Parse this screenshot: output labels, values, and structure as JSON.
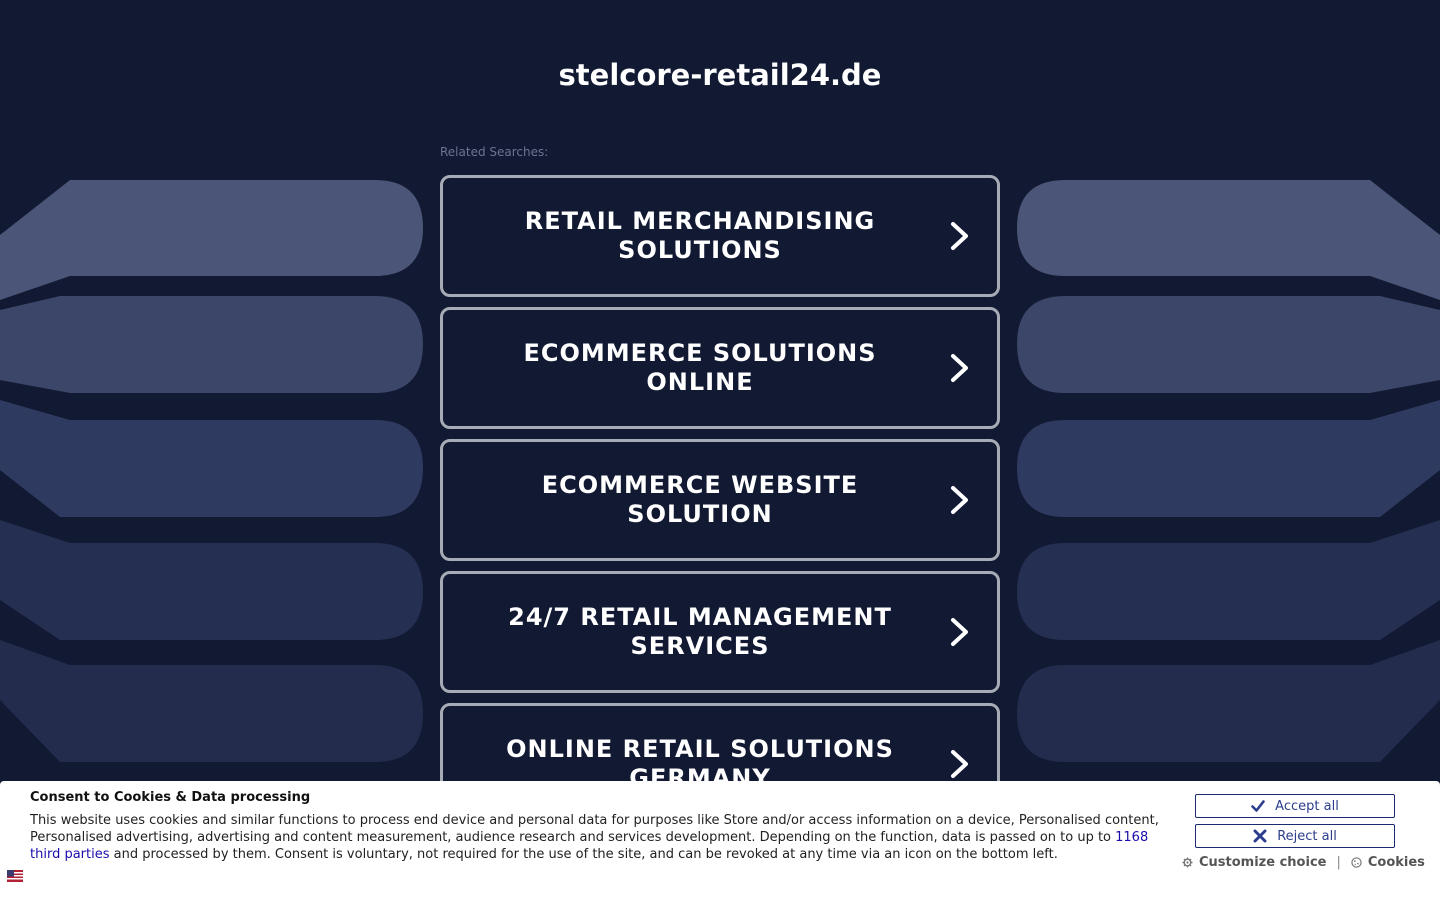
{
  "page": {
    "domain": "stelcore-retail24.de",
    "related_label": "Related Searches:"
  },
  "links": [
    {
      "label": "RETAIL MERCHANDISING SOLUTIONS"
    },
    {
      "label": "ECOMMERCE SOLUTIONS ONLINE"
    },
    {
      "label": "ECOMMERCE WEBSITE SOLUTION"
    },
    {
      "label": "24/7 RETAIL MANAGEMENT SERVICES"
    },
    {
      "label": "ONLINE RETAIL SOLUTIONS GERMANY"
    }
  ],
  "consent": {
    "title": "Consent to Cookies & Data processing",
    "body_before": "This website uses cookies and similar functions to process end device and personal data for purposes like Store and/or access information on a device, Personalised content, Personalised advertising, advertising and content measurement, audience research and services development. Depending on the function, data is passed on to up to ",
    "link_text": "1168 third parties",
    "body_after": " and processed by them. Consent is voluntary, not required for the use of the site, and can be revoked at any time via an icon on the bottom left.",
    "accept_label": "Accept all",
    "reject_label": "Reject all",
    "customize_label": "Customize choice",
    "separator": "|",
    "cookies_label": "Cookies"
  },
  "colors": {
    "background": "#121933",
    "card_border": "#a7abb6",
    "banner_button": "#2c3e8c"
  },
  "icons": {
    "link_arrow": "chevron-right-icon",
    "accept": "check-icon",
    "reject": "x-icon",
    "customize": "gear-icon",
    "cookies": "cookie-icon",
    "language": "flag-icon"
  }
}
